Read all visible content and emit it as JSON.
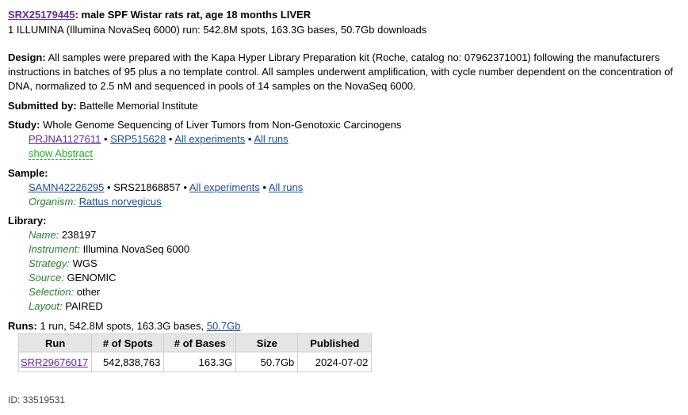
{
  "header": {
    "accession": "SRX25179445",
    "title": ": male SPF Wistar rats rat, age 18 months LIVER",
    "summary": "1 ILLUMINA (Illumina NovaSeq 6000) run: 542.8M spots, 163.3G bases, 50.7Gb downloads"
  },
  "design": {
    "label": "Design:",
    "text": "All samples were prepared with the Kapa Hyper Library Preparation kit (Roche, catalog no: 07962371001) following the manufacturers instructions in batches of 95 plus a no template control. All samples underwent amplification, with cycle number dependent on the concentration of DNA, normalized to 2.5 nM and sequenced in pools of 14 samples on the NovaSeq 6000."
  },
  "submitted": {
    "label": "Submitted by:",
    "value": "Battelle Memorial Institute"
  },
  "study": {
    "label": "Study:",
    "value": "Whole Genome Sequencing of Liver Tumors from Non-Genotoxic Carcinogens",
    "bioproject": "PRJNA1127611",
    "srp": "SRP515628",
    "all_experiments": "All experiments",
    "all_runs": "All runs",
    "sep": "•",
    "show_abstract": "show Abstract"
  },
  "sample": {
    "label": "Sample:",
    "biosample": "SAMN42226295",
    "srs": "SRS21868857",
    "all_experiments": "All experiments",
    "all_runs": "All runs",
    "sep": "•",
    "organism_label": "Organism:",
    "organism": "Rattus norvegicus"
  },
  "library": {
    "label": "Library:",
    "fields": [
      {
        "key": "Name:",
        "value": "238197"
      },
      {
        "key": "Instrument:",
        "value": "Illumina NovaSeq 6000"
      },
      {
        "key": "Strategy:",
        "value": "WGS"
      },
      {
        "key": "Source:",
        "value": "GENOMIC"
      },
      {
        "key": "Selection:",
        "value": "other"
      },
      {
        "key": "Layout:",
        "value": "PAIRED"
      }
    ]
  },
  "runs": {
    "label": "Runs:",
    "summary": "1 run, 542.8M spots, 163.3G bases,",
    "size_link": "50.7Gb",
    "columns": [
      "Run",
      "# of Spots",
      "# of Bases",
      "Size",
      "Published"
    ],
    "rows": [
      {
        "run": "SRR29676017",
        "spots": "542,838,763",
        "bases": "163.3G",
        "size": "50.7Gb",
        "published": "2024-07-02"
      }
    ]
  },
  "footer": {
    "id_line": "ID: 33519531"
  }
}
